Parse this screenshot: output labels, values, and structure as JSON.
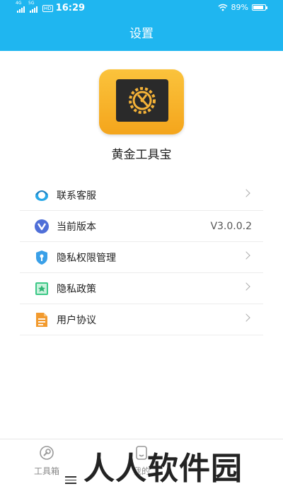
{
  "status_bar": {
    "network_1": "4G",
    "network_2": "5G",
    "hd_badge": "HD",
    "time": "16:29",
    "battery_percent": "89%",
    "battery_level": 0.89
  },
  "header": {
    "title": "设置"
  },
  "app": {
    "name": "黄金工具宝",
    "logo_icon": "gear-compass-icon"
  },
  "menu": [
    {
      "label": "联系客服",
      "icon": "customer-service-icon",
      "icon_color": "#29a8e8"
    },
    {
      "label": "当前版本",
      "icon": "version-icon",
      "icon_color": "#4f6fd8",
      "value": "V3.0.0.2"
    },
    {
      "label": "隐私权限管理",
      "icon": "shield-icon",
      "icon_color": "#3aa0e8"
    },
    {
      "label": "隐私政策",
      "icon": "policy-icon",
      "icon_color": "#3cc887"
    },
    {
      "label": "用户协议",
      "icon": "document-icon",
      "icon_color": "#f29a2e"
    }
  ],
  "tabbar": {
    "tabs": [
      {
        "label": "工具箱",
        "icon": "wrench-icon"
      },
      {
        "label": "我的",
        "icon": "profile-icon"
      }
    ]
  },
  "colors": {
    "primary": "#1fb6f0",
    "logo": "#f4a51c",
    "divider": "#ececec"
  },
  "watermark": "人人软件园"
}
